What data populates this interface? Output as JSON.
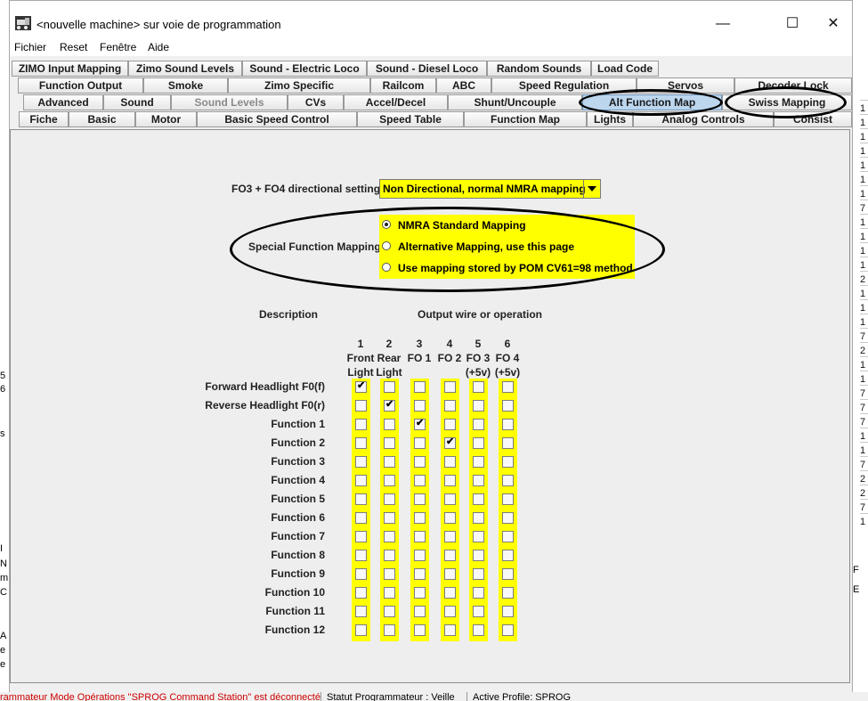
{
  "window": {
    "title": "<nouvelle machine> sur voie de programmation",
    "controls": {
      "minimize": "—",
      "maximize": "☐",
      "close": "✕"
    }
  },
  "menu": [
    "Fichier",
    "Reset",
    "Fenêtre",
    "Aide"
  ],
  "tabs": {
    "row1": [
      "ZIMO Input Mapping",
      "Zimo Sound Levels",
      "Sound - Electric Loco",
      "Sound - Diesel Loco",
      "Random Sounds",
      "Load Code"
    ],
    "row2": [
      "Function Output",
      "Smoke",
      "Zimo Specific",
      "Railcom",
      "ABC",
      "Speed Regulation",
      "Servos",
      "Decoder Lock"
    ],
    "row3": [
      "Advanced",
      "Sound",
      "Sound Levels",
      "CVs",
      "Accel/Decel",
      "Shunt/Uncouple",
      "Alt Function Map",
      "Swiss Mapping"
    ],
    "row4": [
      "Fiche",
      "Basic",
      "Motor",
      "Basic Speed Control",
      "Speed Table",
      "Function Map",
      "Lights",
      "Analog Controls",
      "Consist"
    ],
    "selected": "Alt Function Map",
    "disabled": "Sound Levels"
  },
  "directional": {
    "label": "FO3 + FO4 directional setting",
    "value": "Non Directional, normal NMRA mapping"
  },
  "special_mapping": {
    "label": "Special Function Mapping",
    "options": [
      {
        "label": "NMRA Standard Mapping",
        "selected": true
      },
      {
        "label": "Alternative Mapping, use this page",
        "selected": false
      },
      {
        "label": "Use mapping stored by POM CV61=98 method",
        "selected": false
      }
    ]
  },
  "table": {
    "description_header": "Description",
    "output_header": "Output wire or operation",
    "columns": [
      {
        "num": "1",
        "line1": "Front",
        "line2": "Light"
      },
      {
        "num": "2",
        "line1": "Rear",
        "line2": "Light"
      },
      {
        "num": "3",
        "line1": "FO 1",
        "line2": ""
      },
      {
        "num": "4",
        "line1": "FO 2",
        "line2": ""
      },
      {
        "num": "5",
        "line1": "FO 3",
        "line2": "(+5v)"
      },
      {
        "num": "6",
        "line1": "FO 4",
        "line2": "(+5v)"
      }
    ],
    "rows": [
      {
        "label": "Forward Headlight F0(f)",
        "checked": [
          1,
          0,
          0,
          0,
          0,
          0
        ]
      },
      {
        "label": "Reverse Headlight F0(r)",
        "checked": [
          0,
          1,
          0,
          0,
          0,
          0
        ]
      },
      {
        "label": "Function 1",
        "checked": [
          0,
          0,
          1,
          0,
          0,
          0
        ]
      },
      {
        "label": "Function 2",
        "checked": [
          0,
          0,
          0,
          1,
          0,
          0
        ]
      },
      {
        "label": "Function 3",
        "checked": [
          0,
          0,
          0,
          0,
          0,
          0
        ]
      },
      {
        "label": "Function 4",
        "checked": [
          0,
          0,
          0,
          0,
          0,
          0
        ]
      },
      {
        "label": "Function 5",
        "checked": [
          0,
          0,
          0,
          0,
          0,
          0
        ]
      },
      {
        "label": "Function 6",
        "checked": [
          0,
          0,
          0,
          0,
          0,
          0
        ]
      },
      {
        "label": "Function 7",
        "checked": [
          0,
          0,
          0,
          0,
          0,
          0
        ]
      },
      {
        "label": "Function 8",
        "checked": [
          0,
          0,
          0,
          0,
          0,
          0
        ]
      },
      {
        "label": "Function 9",
        "checked": [
          0,
          0,
          0,
          0,
          0,
          0
        ]
      },
      {
        "label": "Function 10",
        "checked": [
          0,
          0,
          0,
          0,
          0,
          0
        ]
      },
      {
        "label": "Function 11",
        "checked": [
          0,
          0,
          0,
          0,
          0,
          0
        ]
      },
      {
        "label": "Function 12",
        "checked": [
          0,
          0,
          0,
          0,
          0,
          0
        ]
      }
    ]
  },
  "status": {
    "left": "rammateur Mode Opérations \"SPROG Command Station\" est déconnecté",
    "middle": "Statut Programmateur : Veille",
    "right": "Active Profile: SPROG"
  },
  "background": {
    "right_column": [
      "1",
      "1",
      "1",
      "1",
      "1",
      "1",
      "1",
      "7",
      "1",
      "1",
      "1",
      "1",
      "2",
      "1",
      "1",
      "1",
      "7",
      "2",
      "1",
      "1",
      "7",
      "7",
      "7",
      "1",
      "1",
      "7",
      "2",
      "2",
      "7",
      "1"
    ],
    "left_fragments": [
      "5",
      "6",
      "s",
      "I",
      "N",
      "m",
      "C",
      "A",
      "e",
      "e"
    ],
    "right_radios": [
      "F",
      "E"
    ]
  },
  "colors": {
    "highlight": "#ffff00",
    "selected_tab": "#bcd6ee",
    "status_warning": "#cc0000"
  }
}
